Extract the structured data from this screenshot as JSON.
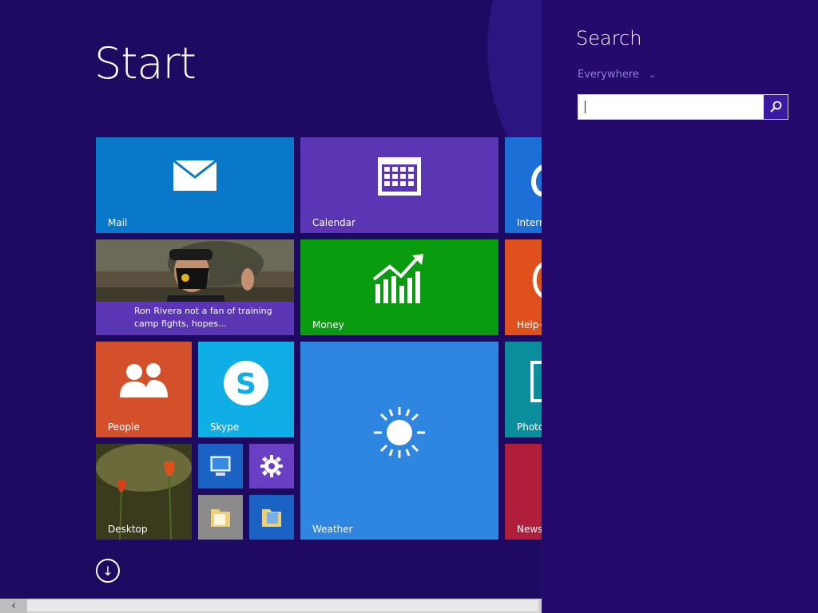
{
  "start": {
    "title": "Start"
  },
  "tiles": {
    "mail": "Mail",
    "calendar": "Calendar",
    "ie": "Intern",
    "news_headline": "Ron Rivera not a fan of training camp fights, hopes...",
    "money": "Money",
    "help": "Help+",
    "people": "People",
    "skype": "Skype",
    "weather": "Weather",
    "photos": "Photo",
    "desktop": "Desktop",
    "news": "News"
  },
  "search_pane": {
    "title": "Search",
    "scope": "Everywhere",
    "input_value": "",
    "input_placeholder": ""
  },
  "colors": {
    "start_background": "#1e0a60",
    "pane_background": "#250a6e",
    "search_button": "#3a1aa0"
  }
}
